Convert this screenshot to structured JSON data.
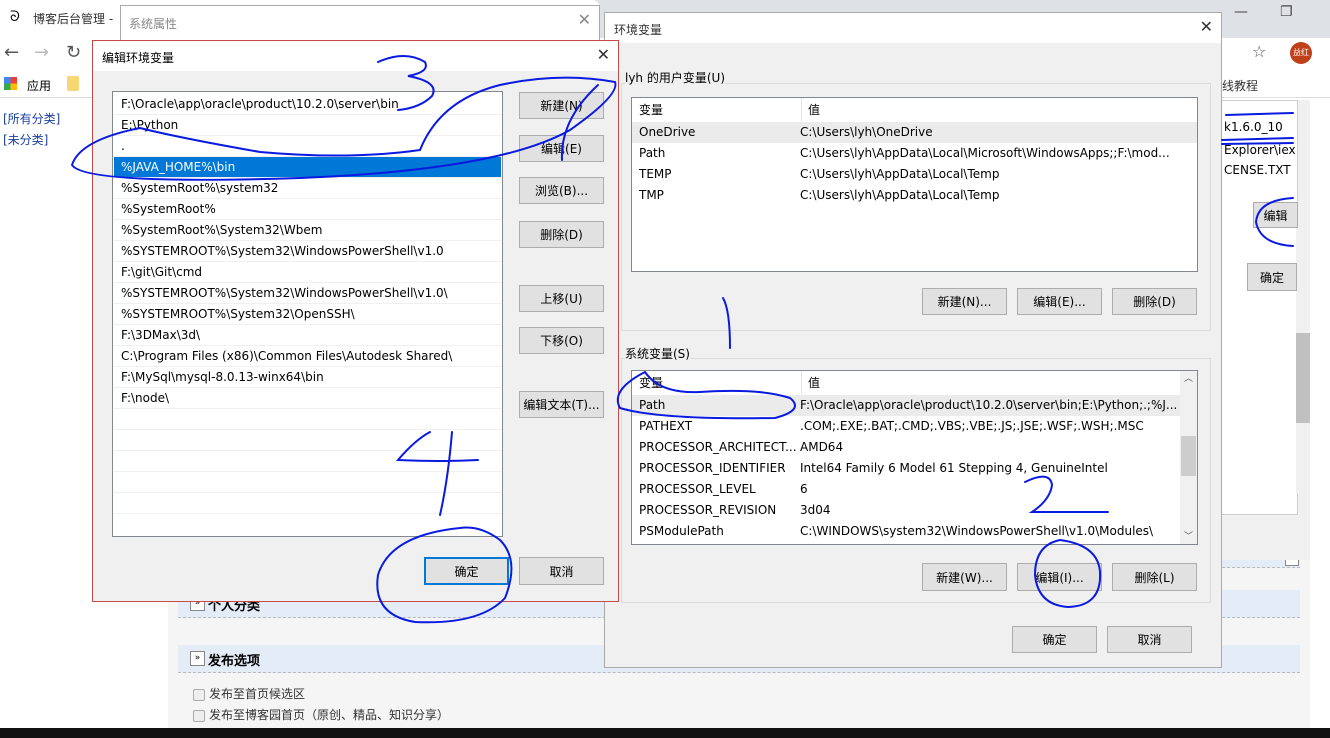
{
  "browser": {
    "tab_title": "博客后台管理 - ",
    "bookmark_apps": "应用",
    "bookmark_right": "线教程",
    "avatar": "益红",
    "left_links": [
      "[所有分类]",
      "[未分类]"
    ]
  },
  "behind_dialog": {
    "title": "系统属性",
    "fragments": [
      "k1.6.0_10",
      "Explorer\\iex",
      "CENSE.TXT"
    ],
    "edit_btn": "编辑",
    "ok_btn": "确定"
  },
  "edit_dialog": {
    "title": "编辑环境变量",
    "entries": [
      "F:\\Oracle\\app\\oracle\\product\\10.2.0\\server\\bin",
      "E:\\Python",
      ".",
      "%JAVA_HOME%\\bin",
      "%SystemRoot%\\system32",
      "%SystemRoot%",
      "%SystemRoot%\\System32\\Wbem",
      "%SYSTEMROOT%\\System32\\WindowsPowerShell\\v1.0",
      "F:\\git\\Git\\cmd",
      "%SYSTEMROOT%\\System32\\WindowsPowerShell\\v1.0\\",
      "%SYSTEMROOT%\\System32\\OpenSSH\\",
      "F:\\3DMax\\3d\\",
      "C:\\Program Files (x86)\\Common Files\\Autodesk Shared\\",
      "F:\\MySql\\mysql-8.0.13-winx64\\bin",
      "F:\\node\\"
    ],
    "selected_index": 3,
    "buttons": {
      "new": "新建(N)",
      "edit": "编辑(E)",
      "browse": "浏览(B)...",
      "delete": "删除(D)",
      "up": "上移(U)",
      "down": "下移(O)",
      "edit_text": "编辑文本(T)...",
      "ok": "确定",
      "cancel": "取消"
    }
  },
  "env_dialog": {
    "title": "环境变量",
    "user_group": "lyh 的用户变量(U)",
    "col_var": "变量",
    "col_val": "值",
    "user_vars": [
      {
        "name": "OneDrive",
        "value": "C:\\Users\\lyh\\OneDrive"
      },
      {
        "name": "Path",
        "value": "C:\\Users\\lyh\\AppData\\Local\\Microsoft\\WindowsApps;;F:\\mod..."
      },
      {
        "name": "TEMP",
        "value": "C:\\Users\\lyh\\AppData\\Local\\Temp"
      },
      {
        "name": "TMP",
        "value": "C:\\Users\\lyh\\AppData\\Local\\Temp"
      }
    ],
    "user_buttons": {
      "new": "新建(N)...",
      "edit": "编辑(E)...",
      "delete": "删除(D)"
    },
    "system_group": "系统变量(S)",
    "system_vars": [
      {
        "name": "Path",
        "value": "F:\\Oracle\\app\\oracle\\product\\10.2.0\\server\\bin;E:\\Python;.;%J..."
      },
      {
        "name": "PATHEXT",
        "value": ".COM;.EXE;.BAT;.CMD;.VBS;.VBE;.JS;.JSE;.WSF;.WSH;.MSC"
      },
      {
        "name": "PROCESSOR_ARCHITECT...",
        "value": "AMD64"
      },
      {
        "name": "PROCESSOR_IDENTIFIER",
        "value": "Intel64 Family 6 Model 61 Stepping 4, GenuineIntel"
      },
      {
        "name": "PROCESSOR_LEVEL",
        "value": "6"
      },
      {
        "name": "PROCESSOR_REVISION",
        "value": "3d04"
      },
      {
        "name": "PSModulePath",
        "value": "C:\\WINDOWS\\system32\\WindowsPowerShell\\v1.0\\Modules\\"
      }
    ],
    "system_buttons": {
      "new": "新建(W)...",
      "edit": "编辑(I)...",
      "delete": "删除(L)"
    },
    "ok": "确定",
    "cancel": "取消"
  },
  "blog": {
    "section_category": "个人分类",
    "section_publish": "发布选项",
    "options": [
      "发布至首页候选区",
      "发布至博客园首页（原创、精品、知识分享）"
    ]
  },
  "annotations": [
    "1",
    "2",
    "3",
    "4"
  ],
  "colors": {
    "selection": "#0078d7",
    "annotation": "#0a1adf",
    "edit_dialog_border": "#c84a4a"
  }
}
